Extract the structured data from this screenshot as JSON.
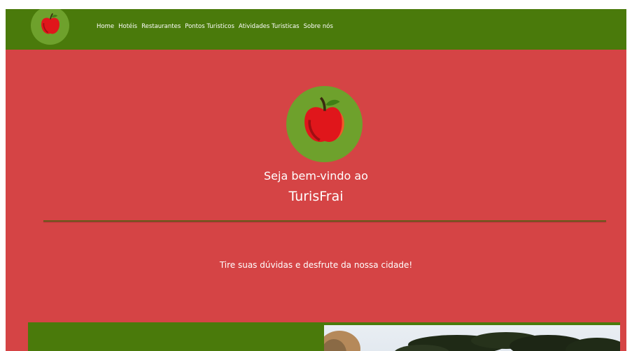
{
  "nav": {
    "links": [
      "Home",
      "Hotéis",
      "Restaurantes",
      "Pontos Turisticos",
      "Atividades Turisticas",
      "Sobre nós"
    ]
  },
  "hero": {
    "welcome": "Seja bem-vindo ao",
    "brand": "TurisFrai",
    "tagline": "Tire suas dúvidas e desfrute da nossa cidade!"
  },
  "colors": {
    "navbar": "#4a7a0b",
    "page_background": "#d54445",
    "logo_circle": "#6ea12c",
    "divider": "#6a5a1a"
  },
  "icons": {
    "logo": "apple-icon"
  }
}
